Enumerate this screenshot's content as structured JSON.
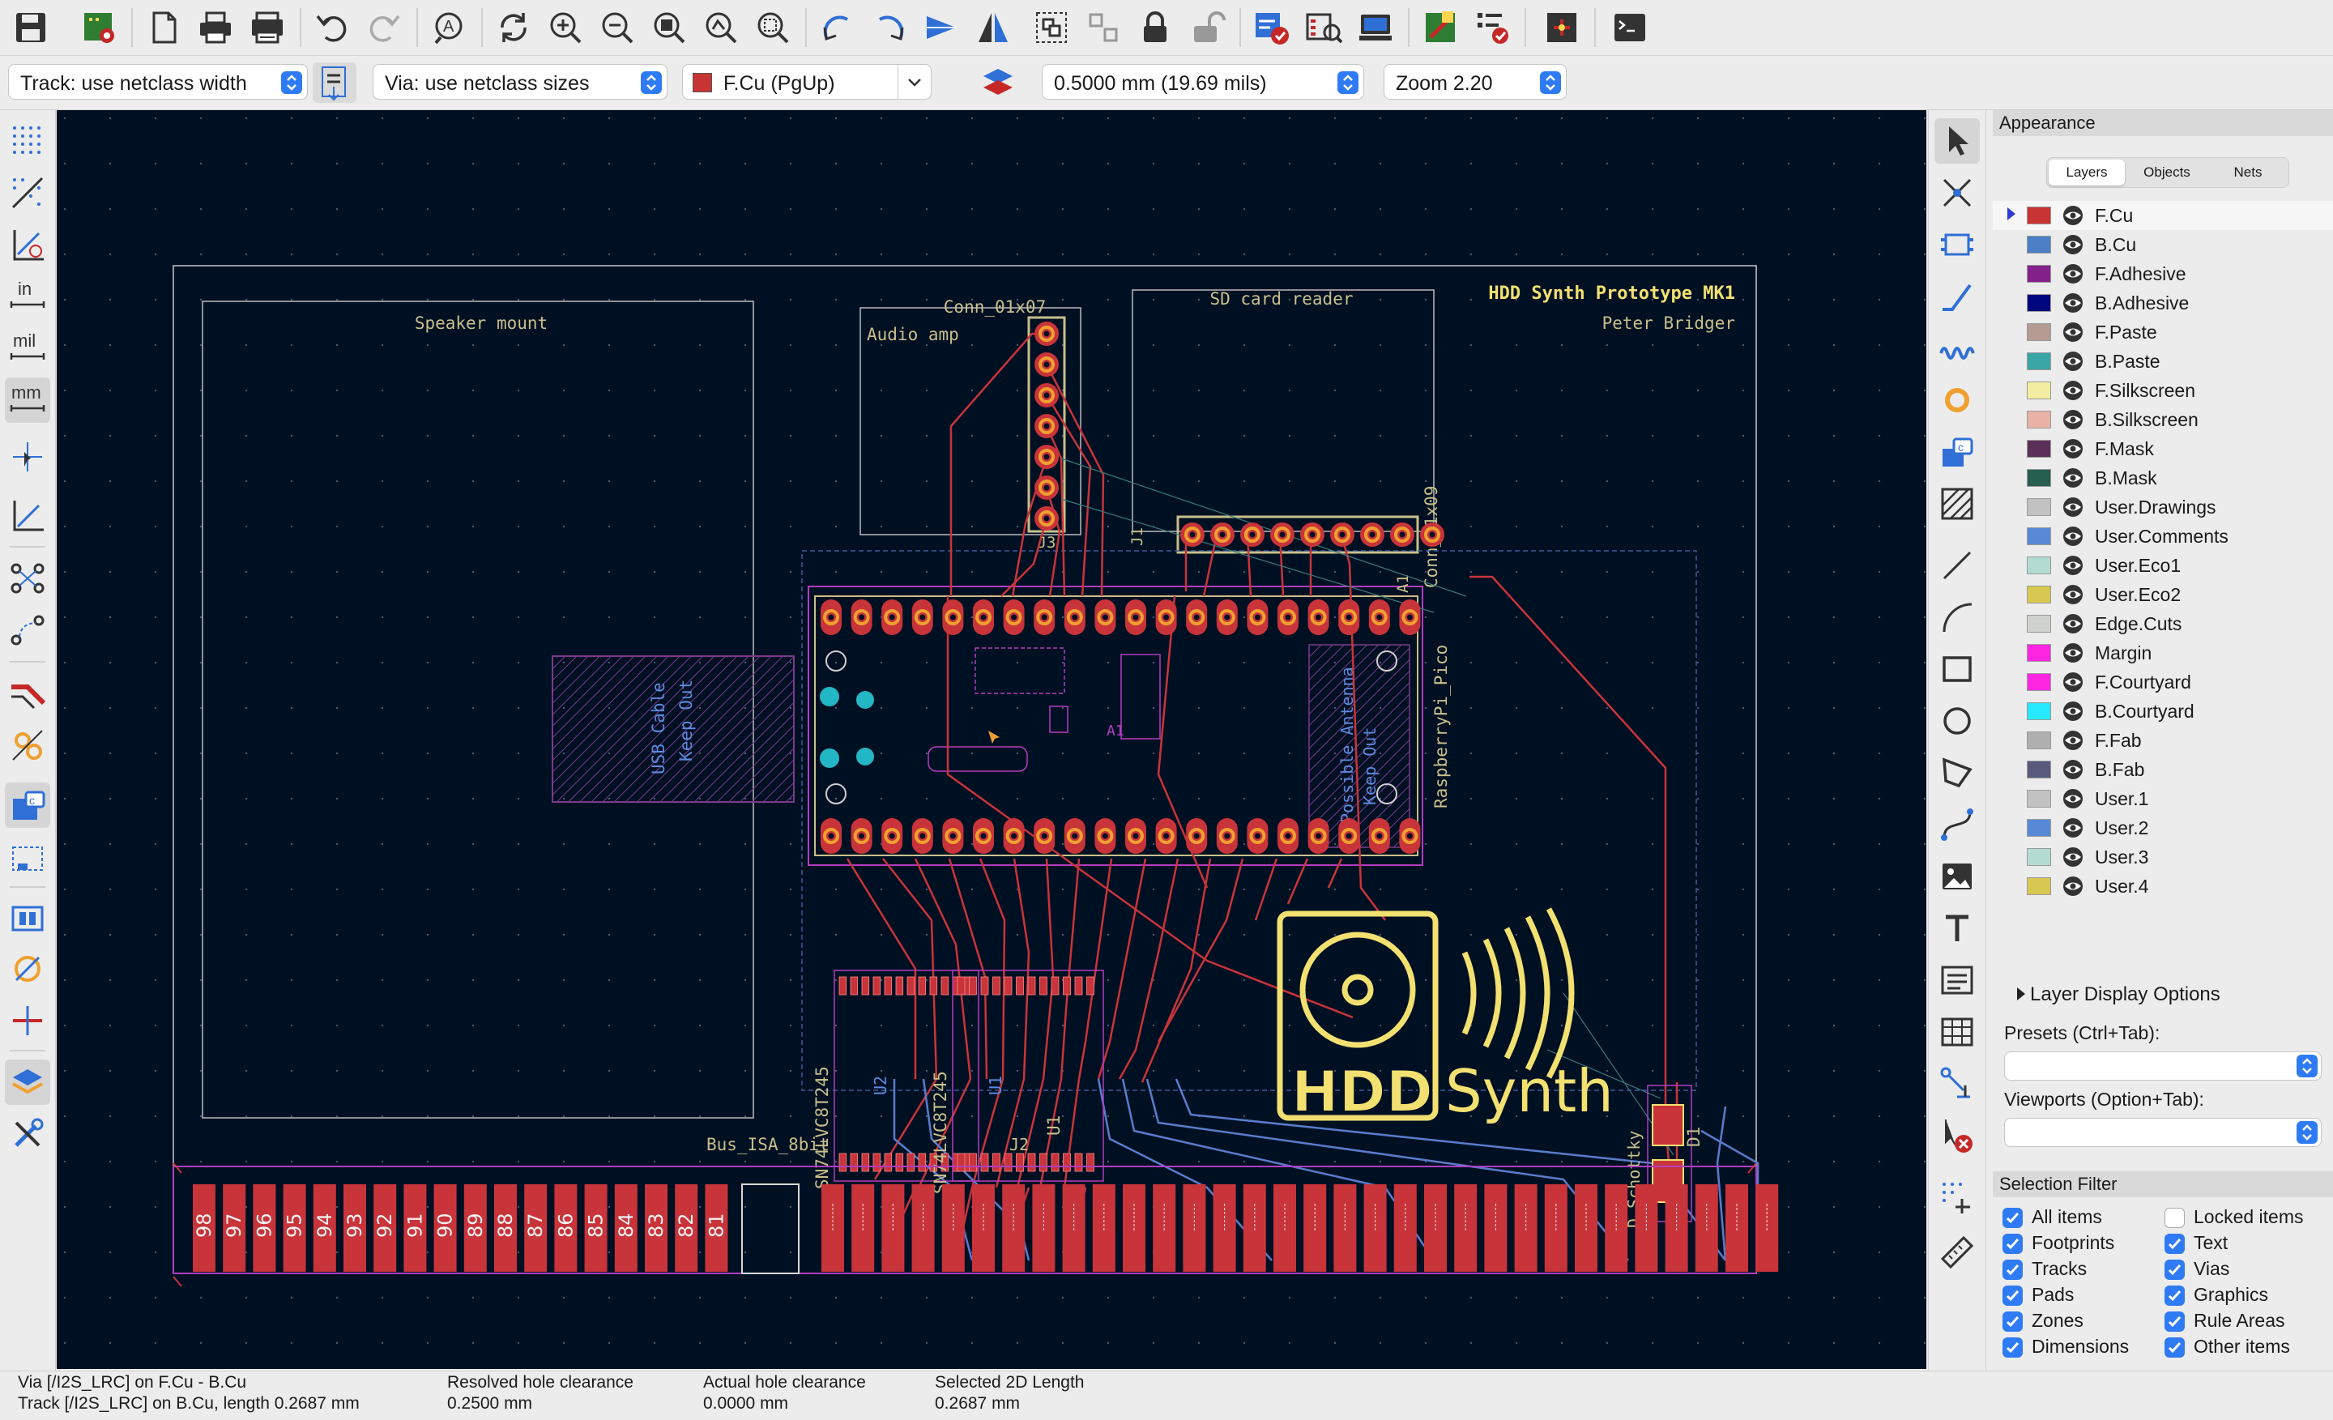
{
  "toolbar": {
    "buttons": [
      "save-icon",
      "board-setup-icon",
      "page-settings-icon",
      "print-icon",
      "plot-icon",
      "undo-icon",
      "redo-icon",
      "find-icon",
      "refresh-icon",
      "zoom-in-icon",
      "zoom-out-icon",
      "zoom-fit-icon",
      "zoom-objects-icon",
      "zoom-selection-icon",
      "rotate-ccw-icon",
      "rotate-cw-icon",
      "flip-horizontal-icon",
      "mirror-icon",
      "group-icon",
      "ungroup-icon",
      "lock-icon",
      "unlock-icon",
      "drc-icon",
      "footprint-browser-icon",
      "footprint-editor-icon",
      "netlist-update-icon",
      "board-check-icon",
      "scripting-icon",
      "console-icon"
    ]
  },
  "options": {
    "track_width": "Track: use netclass width",
    "via_size": "Via: use netclass sizes",
    "layer": "F.Cu (PgUp)",
    "layer_color": "#c83434",
    "grid": "0.5000 mm (19.69 mils)",
    "zoom": "Zoom 2.20"
  },
  "left_tools": [
    "grid-dots-icon",
    "polar-coords-icon",
    "angle-constraint-icon",
    "units-inch-icon",
    "units-mil-icon",
    "units-mm-icon",
    "cursor-full-icon",
    "cursor-angle-icon",
    "ratsnest-icon",
    "ratsnest-curved-icon",
    "track-display-icon",
    "via-display-icon",
    "zone-fill-icon",
    "zone-outline-icon",
    "pad-outline-icon",
    "text-outline-icon",
    "show-layers-icon",
    "high-contrast-icon",
    "layers-manager-icon",
    "properties-icon"
  ],
  "unit_labels": {
    "inch": "in",
    "mil": "mil",
    "mm": "mm"
  },
  "right_tools": [
    "select-icon",
    "local-ratsnest-icon",
    "add-footprint-icon",
    "route-track-icon",
    "tune-length-icon",
    "add-via-icon",
    "add-zone-icon",
    "add-keepout-icon",
    "draw-line-icon",
    "draw-arc-icon",
    "draw-rectangle-icon",
    "draw-circle-icon",
    "draw-polygon-icon",
    "place-bezier-icon",
    "add-image-icon",
    "add-text-icon",
    "add-textbox-icon",
    "add-table-icon",
    "add-dimension-icon",
    "delete-tool-icon",
    "set-origin-icon",
    "measure-icon"
  ],
  "board": {
    "title": "HDD Synth Prototype MK1",
    "author": "Peter Bridger",
    "speaker_mount": "Speaker mount",
    "audio_amp": "Audio amp",
    "conn_top": "Conn_01x07",
    "conn_j3": "J3",
    "sd_reader": "SD card reader",
    "conn_right": "Conn_01x09",
    "conn_j1": "J1",
    "a1_label": "A1",
    "pico": "RaspberryPi_Pico",
    "usb_keepout_line1": "USB Cable",
    "usb_keepout_line2": "Keep Out",
    "antenna_line1": "Possible Antenna",
    "antenna_line2": "Keep Out",
    "ic_left": "SN74LVC8T245",
    "ic_right": "SN74LVC8T245",
    "u2": "U2",
    "u1": "U1",
    "d1": "D1",
    "d_schottky": "D_Schottky",
    "bus": "Bus_ISA_8bit",
    "j2": "J2",
    "logo_hdd": "HDD",
    "logo_synth": "Synth",
    "bottom_pads": [
      "98",
      "97",
      "96",
      "95",
      "94",
      "93",
      "92",
      "91",
      "90",
      "89",
      "88",
      "87",
      "86",
      "85",
      "84",
      "83",
      "82",
      "81"
    ],
    "right_pad_count": 32
  },
  "appearance": {
    "title": "Appearance",
    "tabs": [
      "Layers",
      "Objects",
      "Nets"
    ],
    "layers": [
      {
        "name": "F.Cu",
        "color": "#c83434",
        "active": true
      },
      {
        "name": "B.Cu",
        "color": "#4d7fc4"
      },
      {
        "name": "F.Adhesive",
        "color": "#84218a"
      },
      {
        "name": "B.Adhesive",
        "color": "#00077e"
      },
      {
        "name": "F.Paste",
        "color": "#b49c92"
      },
      {
        "name": "B.Paste",
        "color": "#3aa5a5"
      },
      {
        "name": "F.Silkscreen",
        "color": "#f2eda1"
      },
      {
        "name": "B.Silkscreen",
        "color": "#e8b2a7"
      },
      {
        "name": "F.Mask",
        "color": "#5c2f58"
      },
      {
        "name": "B.Mask",
        "color": "#265e50"
      },
      {
        "name": "User.Drawings",
        "color": "#c2c2c2"
      },
      {
        "name": "User.Comments",
        "color": "#5989d6"
      },
      {
        "name": "User.Eco1",
        "color": "#b4dbd2"
      },
      {
        "name": "User.Eco2",
        "color": "#d8c852"
      },
      {
        "name": "Edge.Cuts",
        "color": "#d0d2cd"
      },
      {
        "name": "Margin",
        "color": "#ff26e2"
      },
      {
        "name": "F.Courtyard",
        "color": "#ff26e2"
      },
      {
        "name": "B.Courtyard",
        "color": "#26e9ff"
      },
      {
        "name": "F.Fab",
        "color": "#afafaf"
      },
      {
        "name": "B.Fab",
        "color": "#58597d"
      },
      {
        "name": "User.1",
        "color": "#c2c2c2"
      },
      {
        "name": "User.2",
        "color": "#5989d6"
      },
      {
        "name": "User.3",
        "color": "#b4dbd2"
      },
      {
        "name": "User.4",
        "color": "#d8c852"
      }
    ],
    "layer_display_options": "Layer Display Options",
    "presets_label": "Presets (Ctrl+Tab):",
    "viewports_label": "Viewports (Option+Tab):"
  },
  "selection_filter": {
    "title": "Selection Filter",
    "items": [
      {
        "label": "All items",
        "checked": true
      },
      {
        "label": "Locked items",
        "checked": false
      },
      {
        "label": "Footprints",
        "checked": true
      },
      {
        "label": "Text",
        "checked": true
      },
      {
        "label": "Tracks",
        "checked": true
      },
      {
        "label": "Vias",
        "checked": true
      },
      {
        "label": "Pads",
        "checked": true
      },
      {
        "label": "Graphics",
        "checked": true
      },
      {
        "label": "Zones",
        "checked": true
      },
      {
        "label": "Rule Areas",
        "checked": true
      },
      {
        "label": "Dimensions",
        "checked": true
      },
      {
        "label": "Other items",
        "checked": true
      }
    ]
  },
  "status": {
    "item_line1": "Via [/I2S_LRC] on F.Cu - B.Cu",
    "item_line2": "Track [/I2S_LRC] on B.Cu, length 0.2687 mm",
    "resolved_label": "Resolved hole clearance",
    "resolved_value": "0.2500 mm",
    "actual_label": "Actual hole clearance",
    "actual_value": "0.0000 mm",
    "length_label": "Selected 2D Length",
    "length_value": "0.2687 mm"
  }
}
